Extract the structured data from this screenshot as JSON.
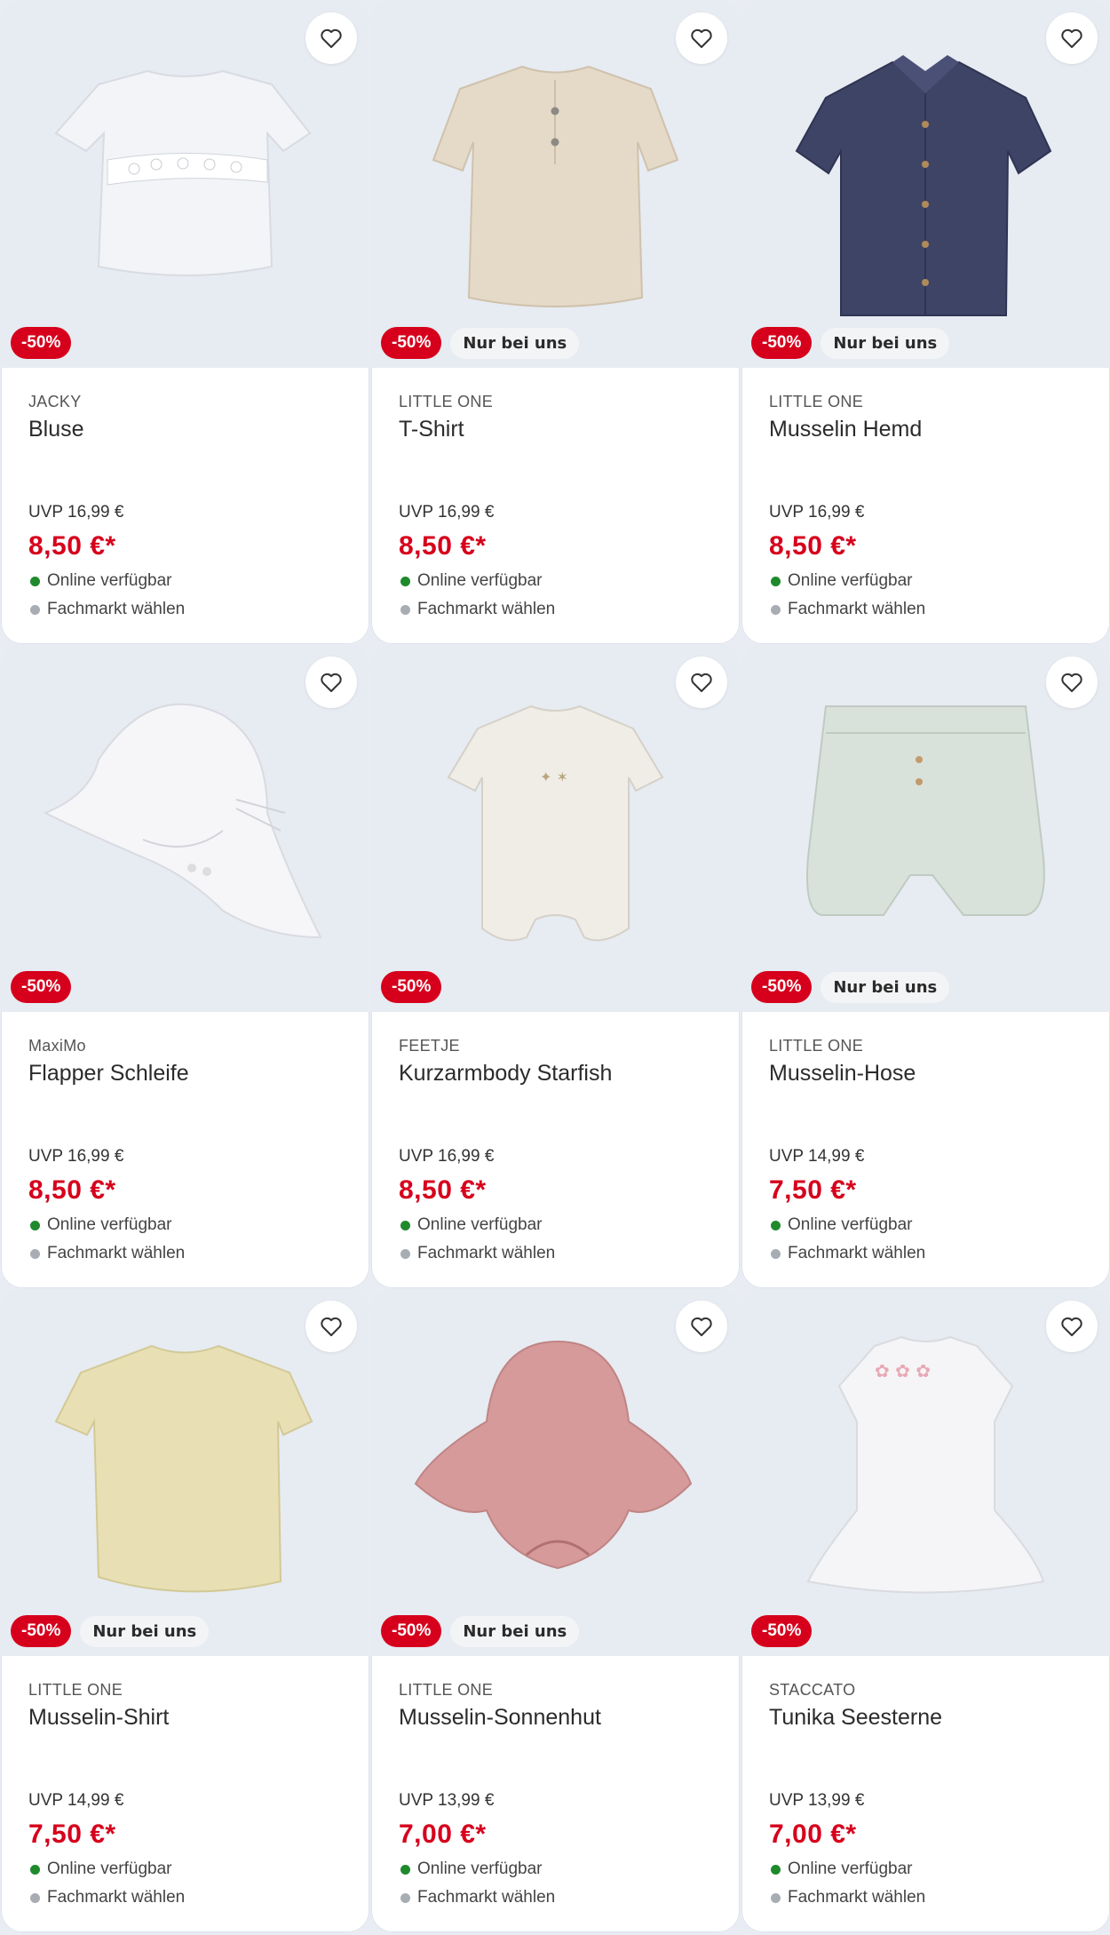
{
  "colors": {
    "price": "#d6001c",
    "discount_badge": "#d6001c",
    "online_dot": "#1f8a2c",
    "store_dot": "#a8adb4"
  },
  "products": [
    {
      "brand": "JACKY",
      "name": "Bluse",
      "uvp": "UVP 16,99 €",
      "price": "8,50 €*",
      "discount": "-50%",
      "exclusive": "",
      "online": "Online verfügbar",
      "store": "Fachmarkt wählen",
      "icon": "white-blouse-image"
    },
    {
      "brand": "LITTLE ONE",
      "name": "T-Shirt",
      "uvp": "UVP 16,99 €",
      "price": "8,50 €*",
      "discount": "-50%",
      "exclusive": "Nur bei uns",
      "online": "Online verfügbar",
      "store": "Fachmarkt wählen",
      "icon": "beige-shirt-image"
    },
    {
      "brand": "LITTLE ONE",
      "name": "Musselin Hemd",
      "uvp": "UVP 16,99 €",
      "price": "8,50 €*",
      "discount": "-50%",
      "exclusive": "Nur bei uns",
      "online": "Online verfügbar",
      "store": "Fachmarkt wählen",
      "icon": "navy-shirt-image"
    },
    {
      "brand": "MaxiMo",
      "name": "Flapper Schleife",
      "uvp": "UVP 16,99 €",
      "price": "8,50 €*",
      "discount": "-50%",
      "exclusive": "",
      "online": "Online verfügbar",
      "store": "Fachmarkt wählen",
      "icon": "white-hat-image"
    },
    {
      "brand": "FEETJE",
      "name": "Kurzarmbody Starfish",
      "uvp": "UVP 16,99 €",
      "price": "8,50 €*",
      "discount": "-50%",
      "exclusive": "",
      "online": "Online verfügbar",
      "store": "Fachmarkt wählen",
      "icon": "cream-body-image"
    },
    {
      "brand": "LITTLE ONE",
      "name": "Musselin-Hose",
      "uvp": "UVP 14,99 €",
      "price": "7,50 €*",
      "discount": "-50%",
      "exclusive": "Nur bei uns",
      "online": "Online verfügbar",
      "store": "Fachmarkt wählen",
      "icon": "mint-shorts-image"
    },
    {
      "brand": "LITTLE ONE",
      "name": "Musselin-Shirt",
      "uvp": "UVP 14,99 €",
      "price": "7,50 €*",
      "discount": "-50%",
      "exclusive": "Nur bei uns",
      "online": "Online verfügbar",
      "store": "Fachmarkt wählen",
      "icon": "yellow-shirt-image"
    },
    {
      "brand": "LITTLE ONE",
      "name": "Musselin-Sonnenhut",
      "uvp": "UVP 13,99 €",
      "price": "7,00 €*",
      "discount": "-50%",
      "exclusive": "Nur bei uns",
      "online": "Online verfügbar",
      "store": "Fachmarkt wählen",
      "icon": "pink-hat-image"
    },
    {
      "brand": "STACCATO",
      "name": "Tunika Seesterne",
      "uvp": "UVP 13,99 €",
      "price": "7,00 €*",
      "discount": "-50%",
      "exclusive": "",
      "online": "Online verfügbar",
      "store": "Fachmarkt wählen",
      "icon": "white-tunic-image"
    }
  ]
}
